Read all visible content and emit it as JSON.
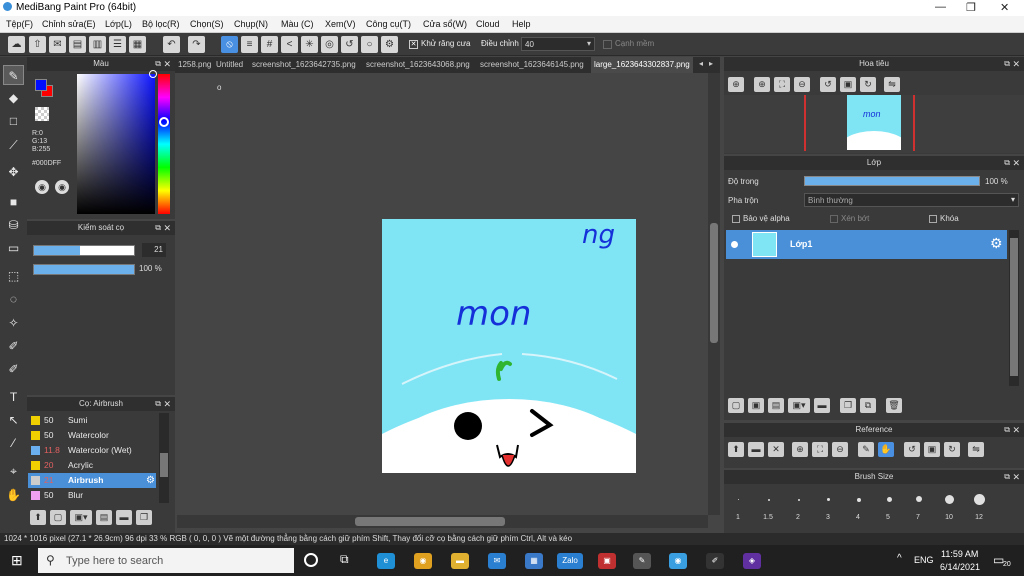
{
  "app": {
    "title": "MediBang Paint Pro (64bit)"
  },
  "menu": [
    "Tệp(F)",
    "Chỉnh sửa(E)",
    "Lớp(L)",
    "Bộ lọc(R)",
    "Chọn(S)",
    "Chụp(N)",
    "Màu (C)",
    "Xem(V)",
    "Công cụ(T)",
    "Cửa sổ(W)",
    "Cloud",
    "Help"
  ],
  "toolbar": {
    "antialias": "Khử răng cưa",
    "adjust_label": "Điều chỉnh",
    "adjust_value": "40",
    "smooth": "Cạnh mềm"
  },
  "color_panel": {
    "title": "Màu",
    "rgb": [
      "R:0",
      "G:13",
      "B:255"
    ],
    "hex": "#000DFF",
    "fg": "#000DFF",
    "bg": "#FF0000"
  },
  "brush_control": {
    "title": "Kiểm soát cọ",
    "size": "21",
    "opacity": "100 %"
  },
  "brush_list": {
    "title": "Cọ: Airbrush",
    "items": [
      {
        "size": "50",
        "name": "Sumi",
        "color": "#f0d000"
      },
      {
        "size": "50",
        "name": "Watercolor",
        "color": "#f0d000"
      },
      {
        "size": "11.8",
        "name": "Watercolor (Wet)",
        "color": "#6ab0f0"
      },
      {
        "size": "20",
        "name": "Acrylic",
        "color": "#f0d000"
      },
      {
        "size": "21",
        "name": "Airbrush",
        "color": "#cccccc"
      },
      {
        "size": "50",
        "name": "Blur",
        "color": "#f0a0f0"
      }
    ]
  },
  "tabs": [
    "1258.png",
    "Untitled",
    "screenshot_1623642735.png",
    "screenshot_1623643068.png",
    "screenshot_1623646145.png",
    "large_1623643302837.png"
  ],
  "canvas": {
    "text_ng": "ng",
    "text_mon": "mon"
  },
  "navigator": {
    "title": "Hoa tiêu"
  },
  "layer": {
    "title": "Lớp",
    "opacity_label": "Độ trong",
    "opacity_value": "100 %",
    "blend_label": "Pha trộn",
    "blend_value": "Bình thường",
    "protect_alpha": "Bảo vệ alpha",
    "clip": "Xén bớt",
    "lock": "Khóa",
    "layer_name": "Lớp1"
  },
  "reference": {
    "title": "Reference"
  },
  "brush_size": {
    "title": "Brush Size",
    "sizes": [
      "1",
      "1.5",
      "2",
      "3",
      "4",
      "5",
      "7",
      "10",
      "12"
    ]
  },
  "status": "1024 * 1016 pixel  (27.1 * 26.9cm)  96 dpi  33 %  RGB ( 0, 0, 0 )  Vẽ một đường thẳng bằng cách giữ phím Shift, Thay đổi cỡ cọ bằng cách giữ phím Ctrl, Alt và kéo",
  "taskbar": {
    "search": "Type here to search",
    "lang": "ENG",
    "time": "11:59 AM",
    "date": "6/14/2021",
    "notif": "20"
  }
}
